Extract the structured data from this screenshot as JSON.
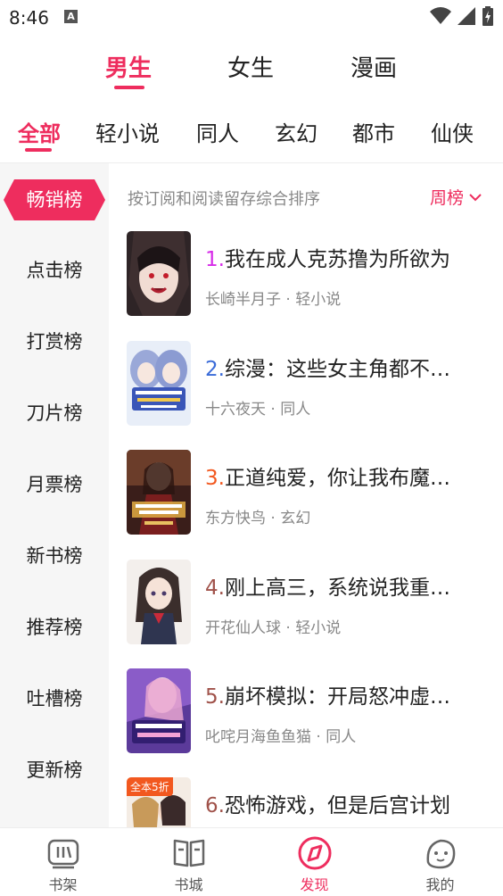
{
  "status": {
    "time": "8:46",
    "notification_letter": "A"
  },
  "gender_tabs": [
    {
      "label": "男生",
      "active": true
    },
    {
      "label": "女生",
      "active": false
    },
    {
      "label": "漫画",
      "active": false
    }
  ],
  "category_tabs": [
    {
      "label": "全部",
      "active": true
    },
    {
      "label": "轻小说"
    },
    {
      "label": "同人"
    },
    {
      "label": "玄幻"
    },
    {
      "label": "都市"
    },
    {
      "label": "仙侠"
    }
  ],
  "sidebar": {
    "items": [
      {
        "label": "畅销榜",
        "active": true
      },
      {
        "label": "点击榜"
      },
      {
        "label": "打赏榜"
      },
      {
        "label": "刀片榜"
      },
      {
        "label": "月票榜"
      },
      {
        "label": "新书榜"
      },
      {
        "label": "推荐榜"
      },
      {
        "label": "吐槽榜"
      },
      {
        "label": "更新榜"
      }
    ]
  },
  "ranking": {
    "description": "按订阅和阅读留存综合排序",
    "period": "周榜"
  },
  "books": [
    {
      "rank": "1.",
      "title": "我在成人克苏撸为所欲为",
      "author": "长崎半月子",
      "category": "轻小说",
      "rank_color": "#d62be8"
    },
    {
      "rank": "2.",
      "title": "综漫：这些女主角都不…",
      "author": "十六夜天",
      "category": "同人",
      "rank_color": "#3a6bd8"
    },
    {
      "rank": "3.",
      "title": "正道纯爱，你让我布魔…",
      "author": "东方快鸟",
      "category": "玄幻",
      "rank_color": "#f2581f"
    },
    {
      "rank": "4.",
      "title": "刚上高三，系统说我重…",
      "author": "开花仙人球",
      "category": "轻小说",
      "rank_color": "#a0524a"
    },
    {
      "rank": "5.",
      "title": "崩坏模拟：开局怒冲虚…",
      "author": "叱咤月海鱼鱼猫",
      "category": "同人",
      "rank_color": "#a0524a"
    },
    {
      "rank": "6.",
      "title": "恐怖游戏，但是后宫计划",
      "author": "",
      "category": "",
      "rank_color": "#a0524a",
      "badge": "全本5折"
    }
  ],
  "meta_separator": " · ",
  "bottom_nav": [
    {
      "label": "书架",
      "icon": "bookshelf-icon"
    },
    {
      "label": "书城",
      "icon": "bookstore-icon"
    },
    {
      "label": "发现",
      "icon": "discover-icon",
      "active": true
    },
    {
      "label": "我的",
      "icon": "profile-icon"
    }
  ],
  "colors": {
    "accent": "#ee2d5e",
    "sidebar_bg": "#f6f6f6",
    "muted_text": "#888888"
  }
}
